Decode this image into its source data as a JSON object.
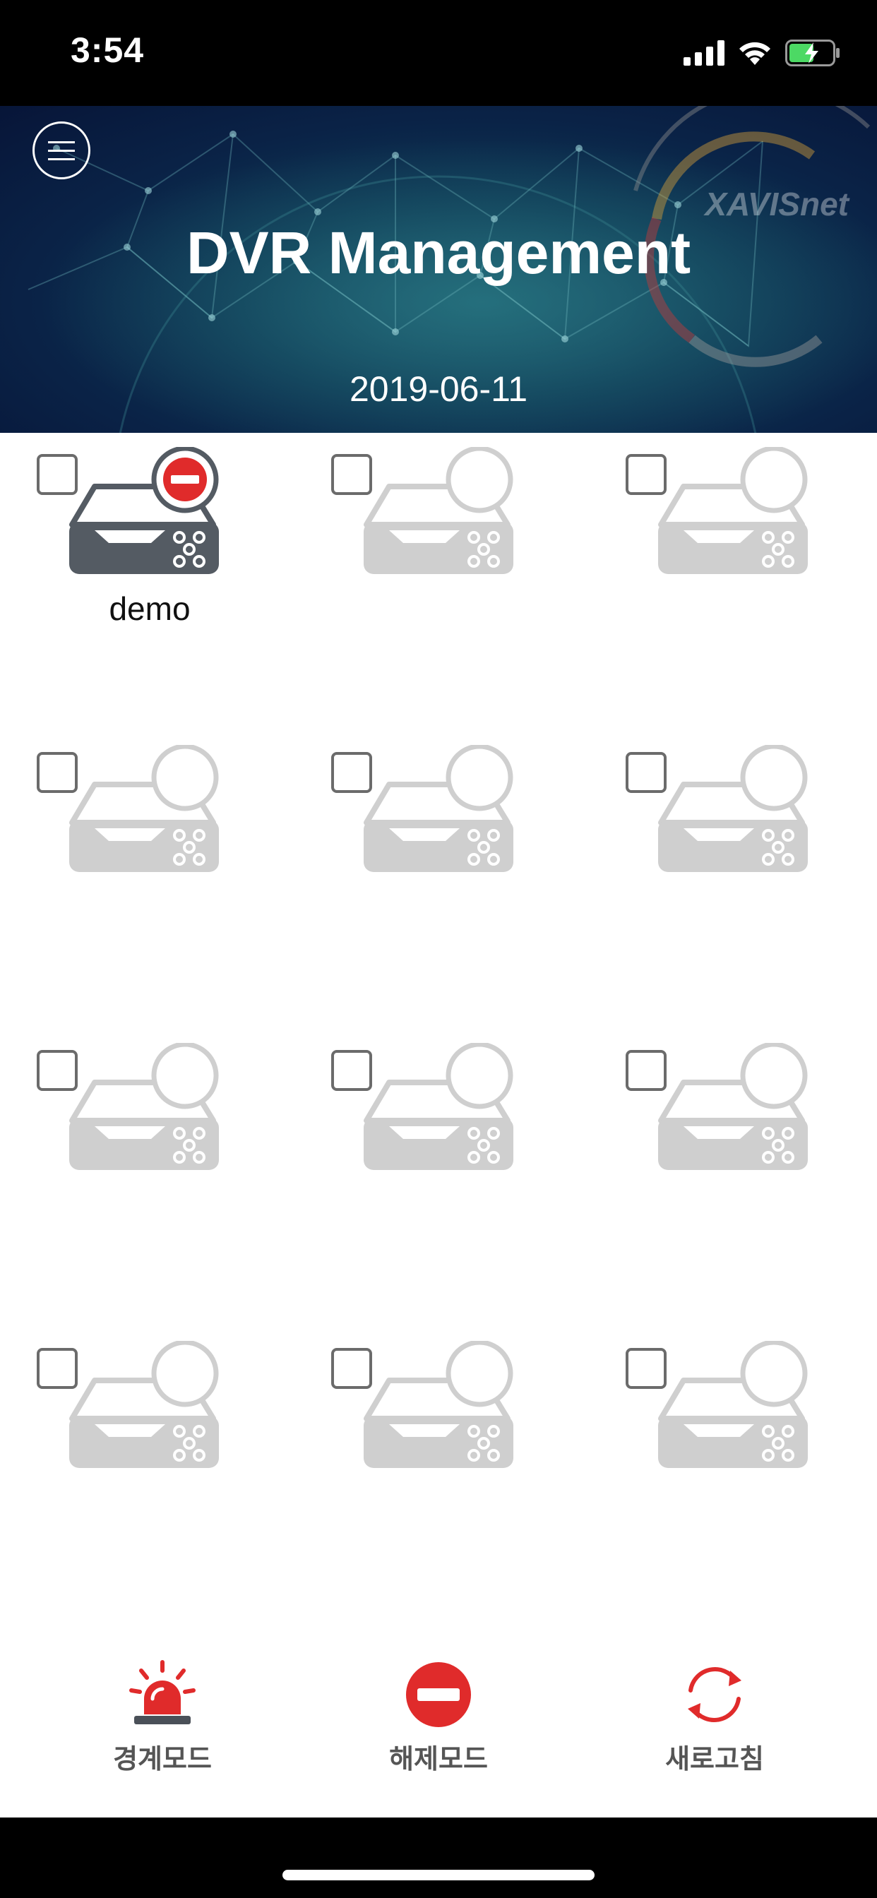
{
  "status_bar": {
    "time": "3:54",
    "icons": [
      "signal-icon",
      "wifi-icon",
      "battery-charging-icon"
    ]
  },
  "header": {
    "title": "DVR Management",
    "date": "2019-06-11",
    "brand": "XAVISnet",
    "menu_icon": "hamburger-menu-icon"
  },
  "devices": [
    {
      "label": "demo",
      "active": true,
      "status": "disarmed"
    },
    {
      "label": "",
      "active": false
    },
    {
      "label": "",
      "active": false
    },
    {
      "label": "",
      "active": false
    },
    {
      "label": "",
      "active": false
    },
    {
      "label": "",
      "active": false
    },
    {
      "label": "",
      "active": false
    },
    {
      "label": "",
      "active": false
    },
    {
      "label": "",
      "active": false
    },
    {
      "label": "",
      "active": false
    },
    {
      "label": "",
      "active": false
    },
    {
      "label": "",
      "active": false
    }
  ],
  "toolbar": {
    "arm_label": "경계모드",
    "disarm_label": "해제모드",
    "refresh_label": "새로고침"
  },
  "colors": {
    "accent_red": "#e02b2b",
    "device_active": "#545b63",
    "device_inactive": "#cfcfcf"
  }
}
